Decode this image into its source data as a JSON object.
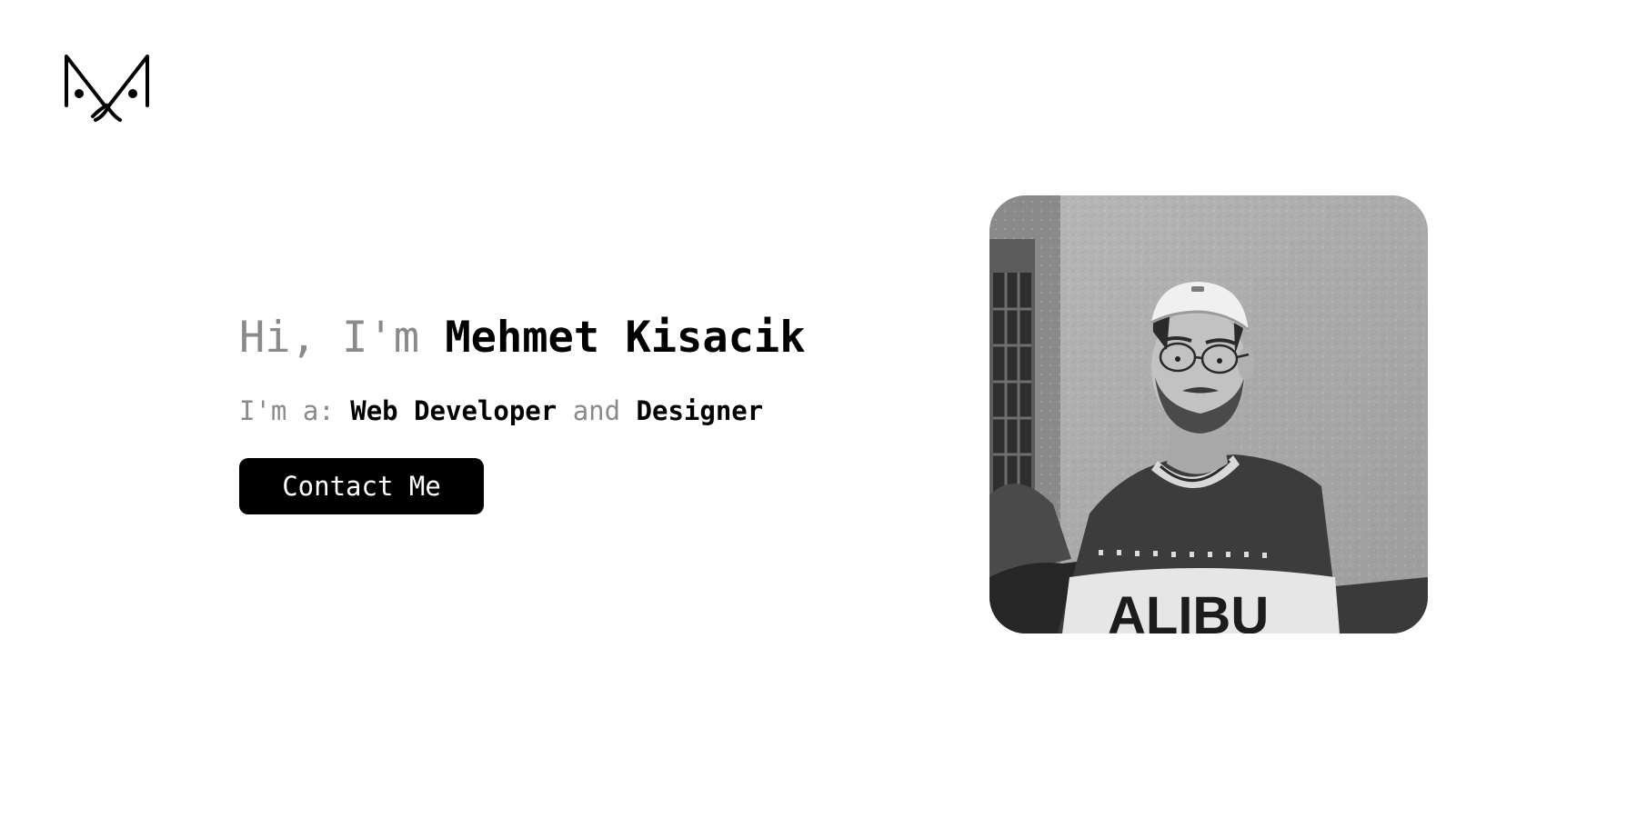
{
  "header": {
    "logo_icon": "mk-monogram-logo-icon"
  },
  "hero": {
    "greeting_prefix": "Hi, I'm",
    "name": "Mehmet Kisacik",
    "role_prefix": "I'm a:",
    "role_primary": "Web Developer",
    "role_joiner": "and",
    "role_secondary": "Designer",
    "contact_label": "Contact Me"
  },
  "portrait": {
    "icon": "portrait-photo",
    "shirt_text": "ALIBU"
  },
  "colors": {
    "background": "#ffffff",
    "text_primary": "#000000",
    "text_muted": "#8a8a8a",
    "button_bg": "#000000",
    "button_text": "#ffffff"
  }
}
